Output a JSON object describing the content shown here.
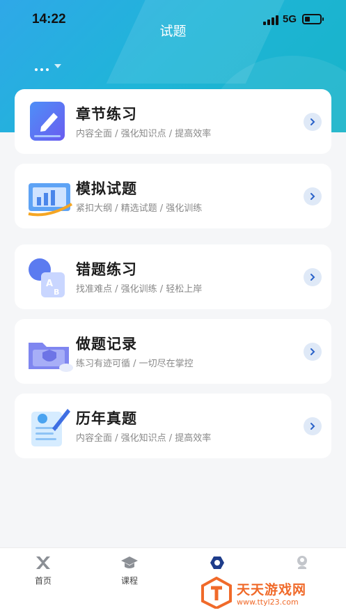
{
  "status_bar": {
    "time": "14:22",
    "network": "5G"
  },
  "header": {
    "title": "试题"
  },
  "cards": [
    {
      "title": "章节练习",
      "subtitle": "内容全面 / 强化知识点 / 提高效率",
      "icon": "pencil-note-icon"
    },
    {
      "title": "模拟试题",
      "subtitle": "紧扣大纲 / 精选试题 / 强化训练",
      "icon": "chart-board-icon"
    },
    {
      "title": "错题练习",
      "subtitle": "找准难点 / 强化训练 / 轻松上岸",
      "icon": "ab-cards-icon"
    },
    {
      "title": "做题记录",
      "subtitle": "练习有迹可循 / 一切尽在掌控",
      "icon": "folder-shield-icon"
    },
    {
      "title": "历年真题",
      "subtitle": "内容全面 / 强化知识点 / 提高效率",
      "icon": "exam-paper-icon"
    }
  ],
  "tabbar": {
    "items": [
      {
        "label": "首页",
        "icon": "home-logo-icon"
      },
      {
        "label": "课程",
        "icon": "graduation-cap-icon"
      },
      {
        "label": "",
        "icon": "question-bank-icon",
        "active": true
      },
      {
        "label": "",
        "icon": "profile-icon"
      }
    ]
  },
  "watermark": {
    "text": "天天游戏网",
    "url": "www.ttyl23.com"
  },
  "colors": {
    "accent": "#1fb0dc",
    "arrow_bg": "#dfe9f7",
    "watermark": "#f06a2a"
  }
}
